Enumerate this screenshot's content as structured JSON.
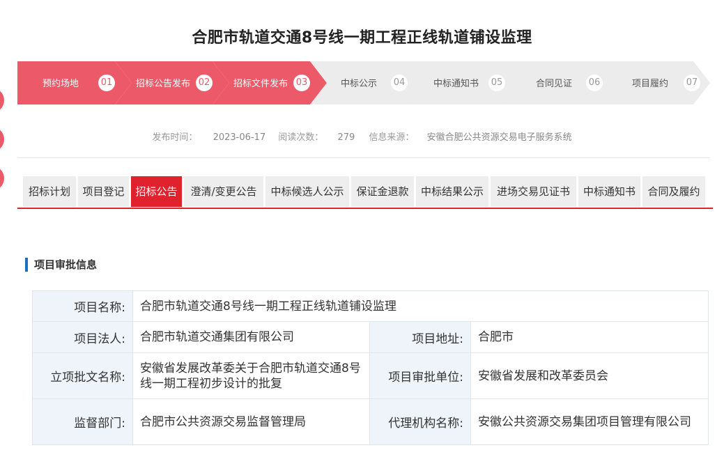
{
  "page": {
    "title": "合肥市轨道交通8号线一期工程正线轨道铺设监理"
  },
  "steps": [
    {
      "label": "预约场地",
      "num": "01",
      "active": true
    },
    {
      "label": "招标公告发布",
      "num": "02",
      "active": true
    },
    {
      "label": "招标文件发布",
      "num": "03",
      "active": true
    },
    {
      "label": "中标公示",
      "num": "04",
      "active": false
    },
    {
      "label": "中标通知书",
      "num": "05",
      "active": false
    },
    {
      "label": "合同见证",
      "num": "06",
      "active": false
    },
    {
      "label": "项目履约",
      "num": "07",
      "active": false
    }
  ],
  "meta": {
    "publish_label": "发布时间：",
    "publish_value": "2023-06-17",
    "reads_label": "阅读次数：",
    "reads_value": "279",
    "source_label": "信息来源：",
    "source_value": "安徽合肥公共资源交易电子服务系统"
  },
  "tabs": [
    {
      "label": "招标计划",
      "active": false
    },
    {
      "label": "项目登记",
      "active": false
    },
    {
      "label": "招标公告",
      "active": true
    },
    {
      "label": "澄清/变更公告",
      "active": false
    },
    {
      "label": "中标候选人公示",
      "active": false
    },
    {
      "label": "保证金退款",
      "active": false
    },
    {
      "label": "中标结果公示",
      "active": false
    },
    {
      "label": "进场交易见证书",
      "active": false
    },
    {
      "label": "中标通知书",
      "active": false
    },
    {
      "label": "合同及履约",
      "active": false
    }
  ],
  "section": {
    "title": "项目审批信息"
  },
  "info": {
    "project_name_label": "项目名称:",
    "project_name": "合肥市轨道交通8号线一期工程正线轨道铺设监理",
    "legal_person_label": "项目法人:",
    "legal_person": "合肥市轨道交通集团有限公司",
    "address_label": "项目地址:",
    "address": "合肥市",
    "approval_doc_label": "立项批文名称:",
    "approval_doc": "安徽省发展改革委关于合肥市轨道交通8号线一期工程初步设计的批复",
    "approval_unit_label": "项目审批单位:",
    "approval_unit": "安徽省发展和改革委员会",
    "supervisor_label": "监督部门:",
    "supervisor": "合肥市公共资源交易监督管理局",
    "agency_label": "代理机构名称:",
    "agency": "安徽公共资源交易集团项目管理有限公司"
  },
  "colors": {
    "step_active": "#ec5a6a",
    "tab_active": "#e0222f",
    "section_bar": "#1b6fc0"
  }
}
